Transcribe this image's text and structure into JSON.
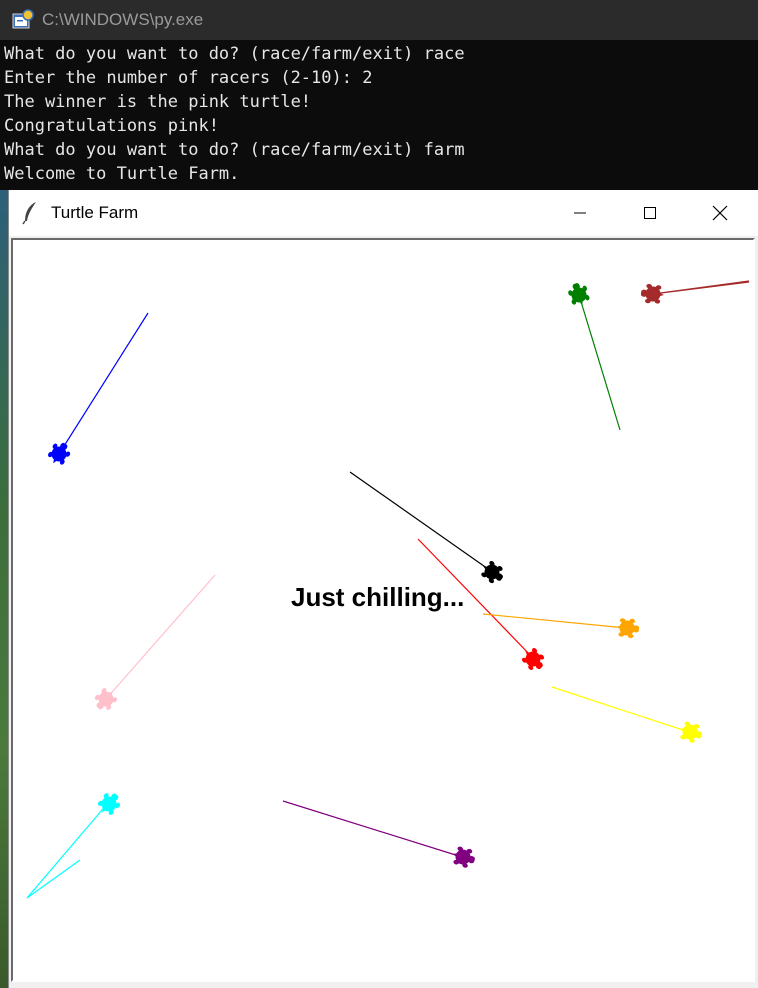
{
  "console": {
    "title": "C:\\WINDOWS\\py.exe",
    "lines": [
      "What do you want to do? (race/farm/exit) race",
      "Enter the number of racers (2-10): 2",
      "The winner is the pink turtle!",
      "Congratulations pink!",
      "What do you want to do? (race/farm/exit) farm",
      "Welcome to Turtle Farm."
    ]
  },
  "tk": {
    "title": "Turtle Farm",
    "canvas_text": "Just chilling...",
    "text_color": "#000000"
  },
  "turtles": [
    {
      "name": "blue",
      "color": "#0000ff"
    },
    {
      "name": "green",
      "color": "#008000"
    },
    {
      "name": "brown",
      "color": "#a52a2a"
    },
    {
      "name": "black",
      "color": "#000000"
    },
    {
      "name": "red",
      "color": "#ff0000"
    },
    {
      "name": "orange",
      "color": "#ffa500"
    },
    {
      "name": "yellow",
      "color": "#ffff00"
    },
    {
      "name": "pink",
      "color": "#ffc0cb"
    },
    {
      "name": "cyan",
      "color": "#00ffff"
    },
    {
      "name": "purple",
      "color": "#800080"
    }
  ]
}
